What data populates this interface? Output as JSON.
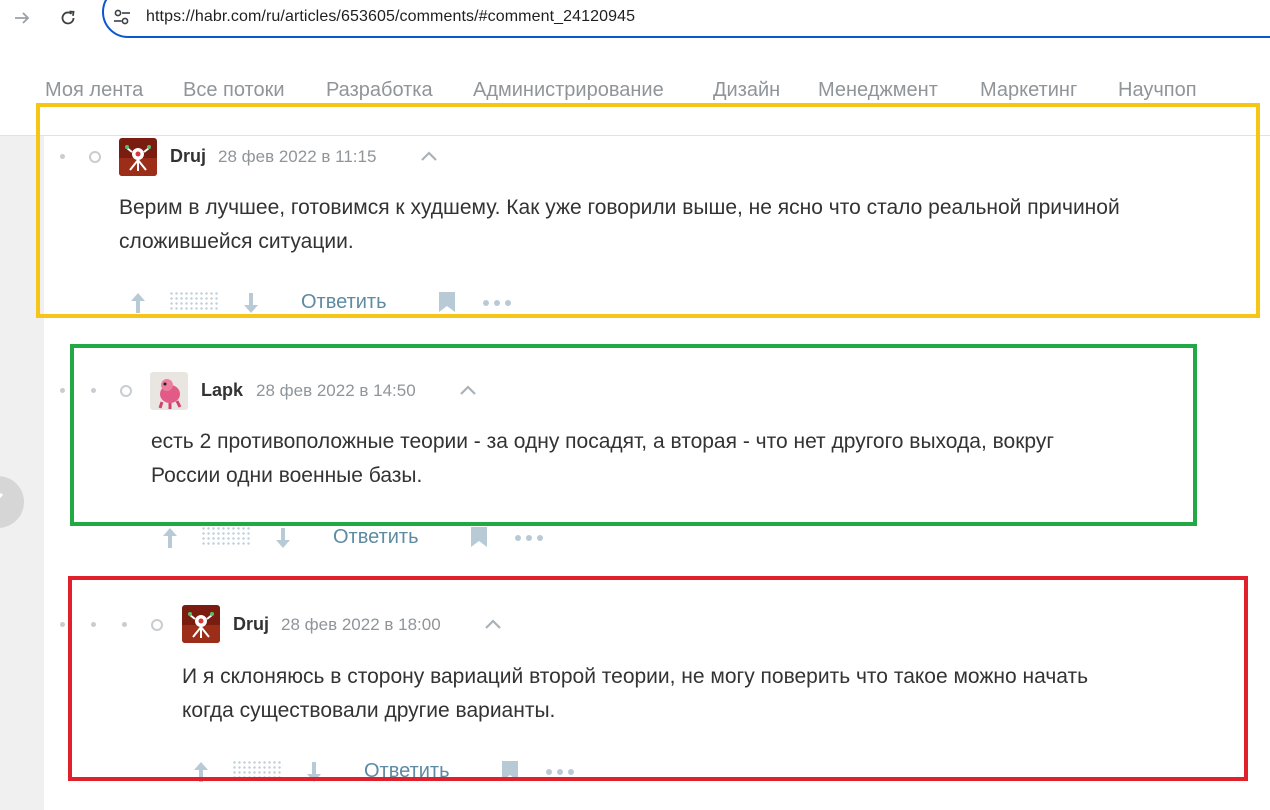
{
  "browser": {
    "url": "https://habr.com/ru/articles/653605/comments/#comment_24120945"
  },
  "flows": [
    "Моя лента",
    "Все потоки",
    "Разработка",
    "Администрирование",
    "Дизайн",
    "Менеджмент",
    "Маркетинг",
    "Научпоп"
  ],
  "comments": [
    {
      "author": "Druj",
      "time": "28 фев 2022 в 11:15",
      "text_line1": "Верим в лучшее, готовимся к худшему. Как уже говорили выше, не ясно что стало реальной причиной",
      "text_line2": "сложившейся ситуации.",
      "reply_label": "Ответить",
      "highlight_color": "#f5c518"
    },
    {
      "author": "Lapk",
      "time": "28 фев 2022 в 14:50",
      "text_line1": "есть 2 противоположные теории - за одну посадят, а вторая - что нет другого выхода, вокруг",
      "text_line2": "России одни военные базы.",
      "reply_label": "Ответить",
      "highlight_color": "#22a845"
    },
    {
      "author": "Druj",
      "time": "28 фев 2022 в 18:00",
      "text_line1": "И я склоняюсь в сторону вариаций второй теории, не могу поверить что такое можно начать",
      "text_line2": "когда существовали другие варианты.",
      "reply_label": "Ответить",
      "highlight_color": "#e0202a"
    }
  ],
  "icons": {
    "back": "arrow-right-icon",
    "reload": "reload-icon",
    "site_info": "tune-icon",
    "vote_up": "arrow-up-icon",
    "vote_down": "arrow-down-icon",
    "collapse": "chevron-up-icon",
    "bookmark": "bookmark-icon",
    "more": "more-dots-icon"
  },
  "colors": {
    "link": "#5e8aa3",
    "muted": "#8f9599",
    "text": "#333333"
  }
}
